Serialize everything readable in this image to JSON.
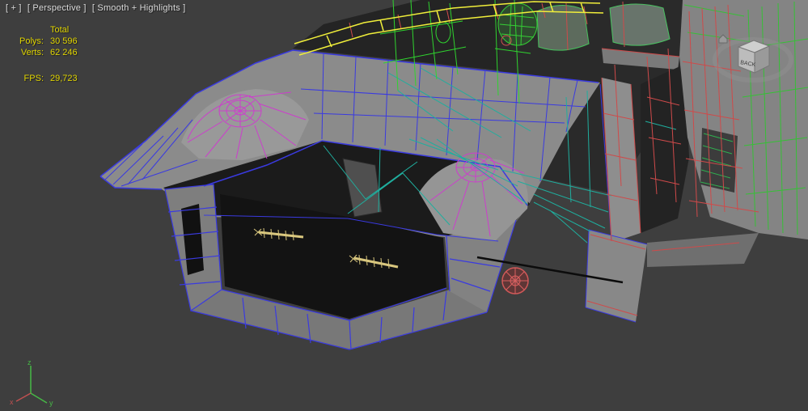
{
  "viewport": {
    "label_general": "[ + ]",
    "label_pov": "[ Perspective ]",
    "label_shading": "[ Smooth + Highlights ]"
  },
  "stats": {
    "total_label": "Total",
    "rows": [
      {
        "label": "Polys:",
        "value": "30 596"
      },
      {
        "label": "Verts:",
        "value": "62 246"
      }
    ],
    "fps_label": "FPS:",
    "fps_value": "29,723",
    "text_color": "#e0d400"
  },
  "viewcube": {
    "face_label": "BACK"
  },
  "axis_gizmo": {
    "z_label": "z",
    "y_label": "y",
    "x_label": "x"
  },
  "scene": {
    "subject": "low-poly-car-body-shell-wireframe",
    "colors": {
      "background": "#3e3e3e",
      "body_gray": "#8b8b8b",
      "interior_dark": "#1b1b1b",
      "wire_blue": "#3a3ae0",
      "wire_magenta": "#cc3ecc",
      "wire_teal": "#1fae9e",
      "wire_green": "#2fd42f",
      "wire_red": "#cf4a4a",
      "selected_edge_yellow": "#f0ee3a",
      "shaft_tan": "#d9c77e"
    }
  }
}
